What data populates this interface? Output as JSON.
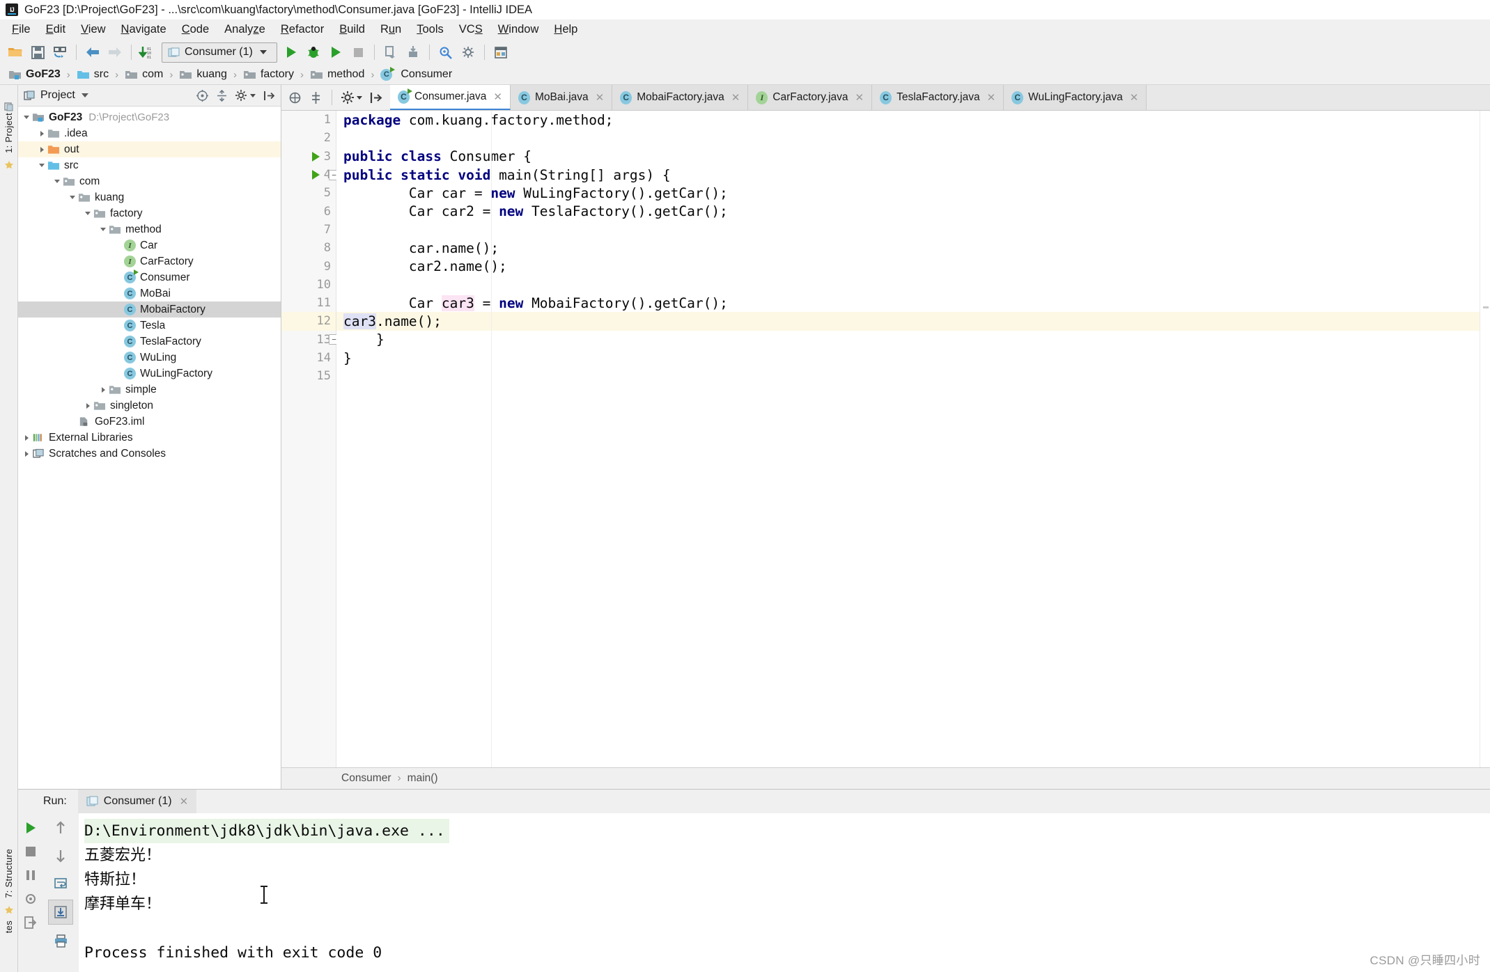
{
  "window": {
    "title": "GoF23 [D:\\Project\\GoF23] - ...\\src\\com\\kuang\\factory\\method\\Consumer.java [GoF23] - IntelliJ IDEA",
    "logo_text": "IJ"
  },
  "menubar": {
    "items": [
      "File",
      "Edit",
      "View",
      "Navigate",
      "Code",
      "Analyze",
      "Refactor",
      "Build",
      "Run",
      "Tools",
      "VCS",
      "Window",
      "Help"
    ]
  },
  "toolbar": {
    "open_icon": "open-folder-icon",
    "save_icon": "save-icon",
    "sync_icon": "sync-icon",
    "back_icon": "back-arrow-icon",
    "forward_icon": "forward-arrow-icon",
    "compile_icon": "compile-icon",
    "run_config": "Consumer (1)",
    "run_icon": "run-icon",
    "debug_icon": "debug-icon",
    "coverage_icon": "run-with-coverage-icon",
    "stop_icon": "stop-icon",
    "updateapp_icon": "update-app-icon",
    "attach_icon": "attach-profiler-icon",
    "search_icon": "search-everywhere-icon",
    "settings_icon": "settings-icon",
    "structure_icon": "project-structure-icon"
  },
  "breadcrumb": {
    "items": [
      {
        "label": "GoF23",
        "icon": "module-icon",
        "bold": true
      },
      {
        "label": "src",
        "icon": "source-folder-icon",
        "bold": false
      },
      {
        "label": "com",
        "icon": "package-icon",
        "bold": false
      },
      {
        "label": "kuang",
        "icon": "package-icon",
        "bold": false
      },
      {
        "label": "factory",
        "icon": "package-icon",
        "bold": false
      },
      {
        "label": "method",
        "icon": "package-icon",
        "bold": false
      },
      {
        "label": "Consumer",
        "icon": "class-icon",
        "bold": false
      }
    ],
    "separator": "›"
  },
  "left_rail": {
    "project_label": "1: Project",
    "favorites_icon": "favorites-icon"
  },
  "bottom_left_rail": {
    "structure_label": "7: Structure",
    "favorites_label": "tes"
  },
  "project_panel": {
    "header_title": "Project",
    "header_icon": "project-view-icon",
    "dropdown_icon": "chevron-down-icon",
    "collapse_icon": "collapse-all-icon",
    "target_icon": "scroll-from-source-icon",
    "gear_icon": "gear-icon",
    "hide_icon": "hide-panel-icon",
    "tree": [
      {
        "label": "GoF23",
        "path": "D:\\Project\\GoF23",
        "depth": 0,
        "arrow": "down",
        "icon": "module-icon",
        "bold": true,
        "state": "normal"
      },
      {
        "label": ".idea",
        "depth": 1,
        "arrow": "right",
        "icon": "folder-icon",
        "state": "normal"
      },
      {
        "label": "out",
        "depth": 1,
        "arrow": "right",
        "icon": "excluded-folder-icon",
        "state": "highlight"
      },
      {
        "label": "src",
        "depth": 1,
        "arrow": "down",
        "icon": "source-folder-icon",
        "state": "normal"
      },
      {
        "label": "com",
        "depth": 2,
        "arrow": "down",
        "icon": "package-icon",
        "state": "normal"
      },
      {
        "label": "kuang",
        "depth": 3,
        "arrow": "down",
        "icon": "package-icon",
        "state": "normal"
      },
      {
        "label": "factory",
        "depth": 4,
        "arrow": "down",
        "icon": "package-icon",
        "state": "normal"
      },
      {
        "label": "method",
        "depth": 5,
        "arrow": "down",
        "icon": "package-icon",
        "state": "normal"
      },
      {
        "label": "Car",
        "depth": 6,
        "arrow": "none",
        "icon": "interface-icon",
        "state": "normal"
      },
      {
        "label": "CarFactory",
        "depth": 6,
        "arrow": "none",
        "icon": "interface-icon",
        "state": "normal"
      },
      {
        "label": "Consumer",
        "depth": 6,
        "arrow": "none",
        "icon": "runnable-class-icon",
        "state": "normal"
      },
      {
        "label": "MoBai",
        "depth": 6,
        "arrow": "none",
        "icon": "class-icon",
        "state": "normal"
      },
      {
        "label": "MobaiFactory",
        "depth": 6,
        "arrow": "none",
        "icon": "class-icon",
        "state": "selected"
      },
      {
        "label": "Tesla",
        "depth": 6,
        "arrow": "none",
        "icon": "class-icon",
        "state": "normal"
      },
      {
        "label": "TeslaFactory",
        "depth": 6,
        "arrow": "none",
        "icon": "class-icon",
        "state": "normal"
      },
      {
        "label": "WuLing",
        "depth": 6,
        "arrow": "none",
        "icon": "class-icon",
        "state": "normal"
      },
      {
        "label": "WuLingFactory",
        "depth": 6,
        "arrow": "none",
        "icon": "class-icon",
        "state": "normal"
      },
      {
        "label": "simple",
        "depth": 5,
        "arrow": "right",
        "icon": "package-icon",
        "state": "normal"
      },
      {
        "label": "singleton",
        "depth": 4,
        "arrow": "right",
        "icon": "package-icon",
        "state": "normal"
      },
      {
        "label": "GoF23.iml",
        "depth": 3,
        "arrow": "none",
        "icon": "iml-file-icon",
        "state": "normal"
      },
      {
        "label": "External Libraries",
        "depth": 0,
        "arrow": "right",
        "icon": "libraries-icon",
        "state": "normal"
      },
      {
        "label": "Scratches and Consoles",
        "depth": 0,
        "arrow": "right",
        "icon": "scratches-icon",
        "state": "normal"
      }
    ]
  },
  "editor_tabs": [
    {
      "label": "Consumer.java",
      "icon": "runnable-class-icon",
      "active": true
    },
    {
      "label": "MoBai.java",
      "icon": "class-icon",
      "active": false
    },
    {
      "label": "MobaiFactory.java",
      "icon": "class-icon",
      "active": false
    },
    {
      "label": "CarFactory.java",
      "icon": "interface-icon",
      "active": false
    },
    {
      "label": "TeslaFactory.java",
      "icon": "class-icon",
      "active": false
    },
    {
      "label": "WuLingFactory.java",
      "icon": "class-icon",
      "active": false
    }
  ],
  "editor": {
    "lines": [
      {
        "n": "1",
        "gutter_run": false,
        "fold": false,
        "highlight": false,
        "html": "<span class='kw'>package</span> com.kuang.factory.method;"
      },
      {
        "n": "2",
        "gutter_run": false,
        "fold": false,
        "highlight": false,
        "html": ""
      },
      {
        "n": "3",
        "gutter_run": true,
        "fold": false,
        "highlight": false,
        "html": "<span class='kw'>public class</span> Consumer {"
      },
      {
        "n": "4",
        "gutter_run": true,
        "fold": true,
        "highlight": false,
        "html": "    <span class='kw'>public static void</span> main(String[] args) {"
      },
      {
        "n": "5",
        "gutter_run": false,
        "fold": false,
        "highlight": false,
        "html": "        Car car = <span class='kw'>new</span> WuLingFactory().getCar();"
      },
      {
        "n": "6",
        "gutter_run": false,
        "fold": false,
        "highlight": false,
        "html": "        Car car2 = <span class='kw'>new</span> TeslaFactory().getCar();"
      },
      {
        "n": "7",
        "gutter_run": false,
        "fold": false,
        "highlight": false,
        "html": ""
      },
      {
        "n": "8",
        "gutter_run": false,
        "fold": false,
        "highlight": false,
        "html": "        car.name();"
      },
      {
        "n": "9",
        "gutter_run": false,
        "fold": false,
        "highlight": false,
        "html": "        car2.name();"
      },
      {
        "n": "10",
        "gutter_run": false,
        "fold": false,
        "highlight": false,
        "html": ""
      },
      {
        "n": "11",
        "gutter_run": false,
        "fold": false,
        "highlight": false,
        "html": "        Car <span class='pink'>car3</span> = <span class='kw'>new</span> MobaiFactory().getCar();"
      },
      {
        "n": "12",
        "gutter_run": false,
        "fold": false,
        "highlight": true,
        "html": "        <span class='lav'>car3</span>.name();"
      },
      {
        "n": "13",
        "gutter_run": false,
        "fold": true,
        "highlight": false,
        "html": "    }"
      },
      {
        "n": "14",
        "gutter_run": false,
        "fold": false,
        "highlight": false,
        "html": "}"
      },
      {
        "n": "15",
        "gutter_run": false,
        "fold": false,
        "highlight": false,
        "html": ""
      }
    ],
    "plain_text": [
      "package com.kuang.factory.method;",
      "",
      "public class Consumer {",
      "    public static void main(String[] args) {",
      "        Car car = new WuLingFactory().getCar();",
      "        Car car2 = new TeslaFactory().getCar();",
      "",
      "        car.name();",
      "        car2.name();",
      "",
      "        Car car3 = new MobaiFactory().getCar();",
      "        car3.name();",
      "    }",
      "}",
      ""
    ],
    "status_breadcrumb": [
      "Consumer",
      "main()"
    ],
    "status_separator": "›"
  },
  "run_panel": {
    "label": "Run:",
    "tab": {
      "label": "Consumer (1)",
      "icon": "run-configuration-icon",
      "close_icon": "close-icon"
    },
    "rail_buttons": [
      "rerun-icon",
      "stop-icon",
      "pause-icon",
      "dump-threads-icon",
      "exit-icon"
    ],
    "rail2_buttons": [
      "up-arrow-icon",
      "down-arrow-icon",
      "soft-wrap-icon",
      "scroll-to-end-icon",
      "print-icon"
    ],
    "console": [
      {
        "text": "D:\\Environment\\jdk8\\jdk\\bin\\java.exe ...",
        "style": "cmd"
      },
      {
        "text": "五菱宏光！",
        "style": "cjk"
      },
      {
        "text": "特斯拉！",
        "style": "cjk"
      },
      {
        "text": "摩拜单车！",
        "style": "cjk"
      },
      {
        "text": "",
        "style": "plain"
      },
      {
        "text": "Process finished with exit code 0",
        "style": "plain"
      }
    ]
  },
  "watermark": "CSDN @只睡四小时",
  "colors": {
    "keyword": "#00007F",
    "accent": "#3E86D6",
    "run_green": "#41A318",
    "selection": "#D4D4D4",
    "caret_line": "#FDF8E3",
    "console_cmd_bg": "#E9F5E6"
  }
}
